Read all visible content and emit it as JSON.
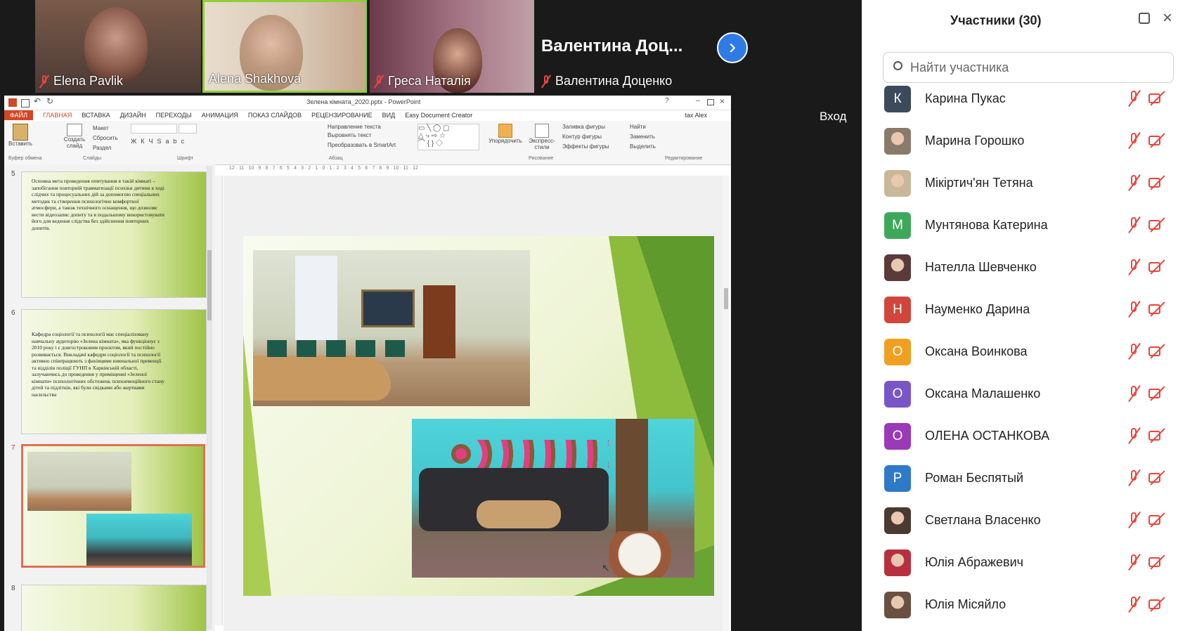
{
  "videos": [
    {
      "name": "Elena Pavlik",
      "muted": true
    },
    {
      "name": "Alena Shakhova",
      "muted": false
    },
    {
      "name": "Греса Наталія",
      "muted": true
    },
    {
      "name": "Валентина Доценко",
      "muted": true,
      "big_name": "Валентина  Доц..."
    }
  ],
  "next_label": "›",
  "login_label": "Вход",
  "ppt": {
    "title": "Зелена кімната_2020.pptx - PowerPoint",
    "tabs": [
      "ФАЙЛ",
      "ГЛАВНАЯ",
      "ВСТАВКА",
      "ДИЗАЙН",
      "ПЕРЕХОДЫ",
      "АНИМАЦИЯ",
      "ПОКАЗ СЛАЙДОВ",
      "РЕЦЕНЗИРОВАНИЕ",
      "ВИД",
      "Easy Document Creator"
    ],
    "user": "tax Alex",
    "ribbon": {
      "paste": "Вставить",
      "create_slide": "Создать слайд",
      "layout": "Макет",
      "reset": "Сбросить",
      "section": "Раздел",
      "text_direction": "Направление текста",
      "align_text": "Выровнять текст",
      "smartart": "Преобразовать в SmartArt",
      "arrange": "Упорядочить",
      "quick_styles": "Экспресс-стили",
      "shape_fill": "Заливка фигуры",
      "shape_outline": "Контур фигуры",
      "shape_effects": "Эффекты фигуры",
      "find": "Найти",
      "replace": "Заменить",
      "select": "Выделить",
      "groups": [
        "Буфер обмена",
        "Слайды",
        "Шрифт",
        "Абзац",
        "Рисование",
        "Редактирование"
      ]
    },
    "slides": [
      {
        "num": "5",
        "text": "Основна мета проведення опитування в такій кімнаті – запобігання повторній травматизації психіки дитини в ході слідчих та процесуальних дій за допомогою спеціальних методик та створення психологічно комфортної атмосфери, а також технічного оснащення, що дозволяє вести відеозапис допиту та в подальшому використовувати його для ведення слідства без здійснення повторних допитів."
      },
      {
        "num": "6",
        "text": "Кафедра соціології та психології має спеціалізовану навчальну аудиторію «Зелена кімната», яка функціонує з 2010 року і є довгостроковим проєктом, який постійно розвивається. Викладачі кафедри соціології та психології активно співпрацюють з фахівцями ювенальної превенції та відділів поліції ГУНП в Харківській області, залучаючись до проведення у приміщенні «Зеленої кімнати» психологічних обстежень психоемоційного стану дітей та підлітків, які були свідками або жертвами насильства"
      },
      {
        "num": "7",
        "text": ""
      },
      {
        "num": "8",
        "text": ""
      }
    ],
    "ruler": "12 · 11 · 10 · 9 · 8 · 7 · 6 · 5 · 4 · 3 · 2 · 1 · 0 · 1 · 2 · 3 · 4 · 5 · 6 · 7 · 8 · 9 · 10 · 11 · 12"
  },
  "panel": {
    "title": "Участники (30)",
    "search_placeholder": "Найти участника",
    "participants": [
      {
        "initial": "К",
        "name": "Карина Пукас",
        "color": "#3b4a5c",
        "photo": false
      },
      {
        "initial": "",
        "name": "Марина Горошко",
        "color": "#8a7a6a",
        "photo": true
      },
      {
        "initial": "",
        "name": "Мікіртич'ян Тетяна",
        "color": "#c9b79a",
        "photo": true
      },
      {
        "initial": "М",
        "name": "Мунтянова Катерина",
        "color": "#3ea85a",
        "photo": false
      },
      {
        "initial": "",
        "name": "Нателла Шевченко",
        "color": "#5a3a3a",
        "photo": true
      },
      {
        "initial": "Н",
        "name": "Науменко Дарина",
        "color": "#d0463a",
        "photo": false
      },
      {
        "initial": "О",
        "name": "Оксана Воинкова",
        "color": "#f0a020",
        "photo": false
      },
      {
        "initial": "О",
        "name": "Оксана Малашенко",
        "color": "#7a55c8",
        "photo": false
      },
      {
        "initial": "О",
        "name": "ОЛЕНА ОСТАНКОВА",
        "color": "#9a3ab8",
        "photo": false
      },
      {
        "initial": "Р",
        "name": "Роман Беспятый",
        "color": "#2e7ac8",
        "photo": false
      },
      {
        "initial": "",
        "name": "Светлана Власенко",
        "color": "#4a3a30",
        "photo": true
      },
      {
        "initial": "",
        "name": "Юлія Абражевич",
        "color": "#b83040",
        "photo": true
      },
      {
        "initial": "",
        "name": "Юлія Місяйло",
        "color": "#6a5040",
        "photo": true
      }
    ]
  }
}
